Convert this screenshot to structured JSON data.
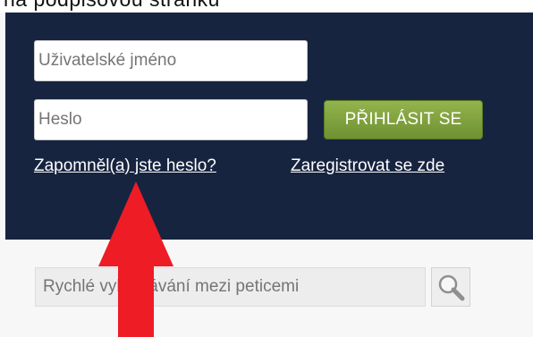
{
  "page_fragment": "na podpisovou stránku",
  "login": {
    "username_placeholder": "Uživatelské jméno",
    "password_placeholder": "Heslo",
    "submit_label": "PŘIHLÁSIT SE",
    "forgot_password_link": "Zapomněl(a) jste heslo?",
    "register_link": "Zaregistrovat se zde"
  },
  "search": {
    "placeholder": "Rychlé vyhledávání mezi peticemi",
    "button_icon": "search-icon"
  },
  "annotation": {
    "icon": "arrow-up-icon",
    "color": "#ee1c25"
  },
  "colors": {
    "panel_bg": "#172440",
    "button_green": "#7d9f3a",
    "link_text": "#ffffff"
  }
}
